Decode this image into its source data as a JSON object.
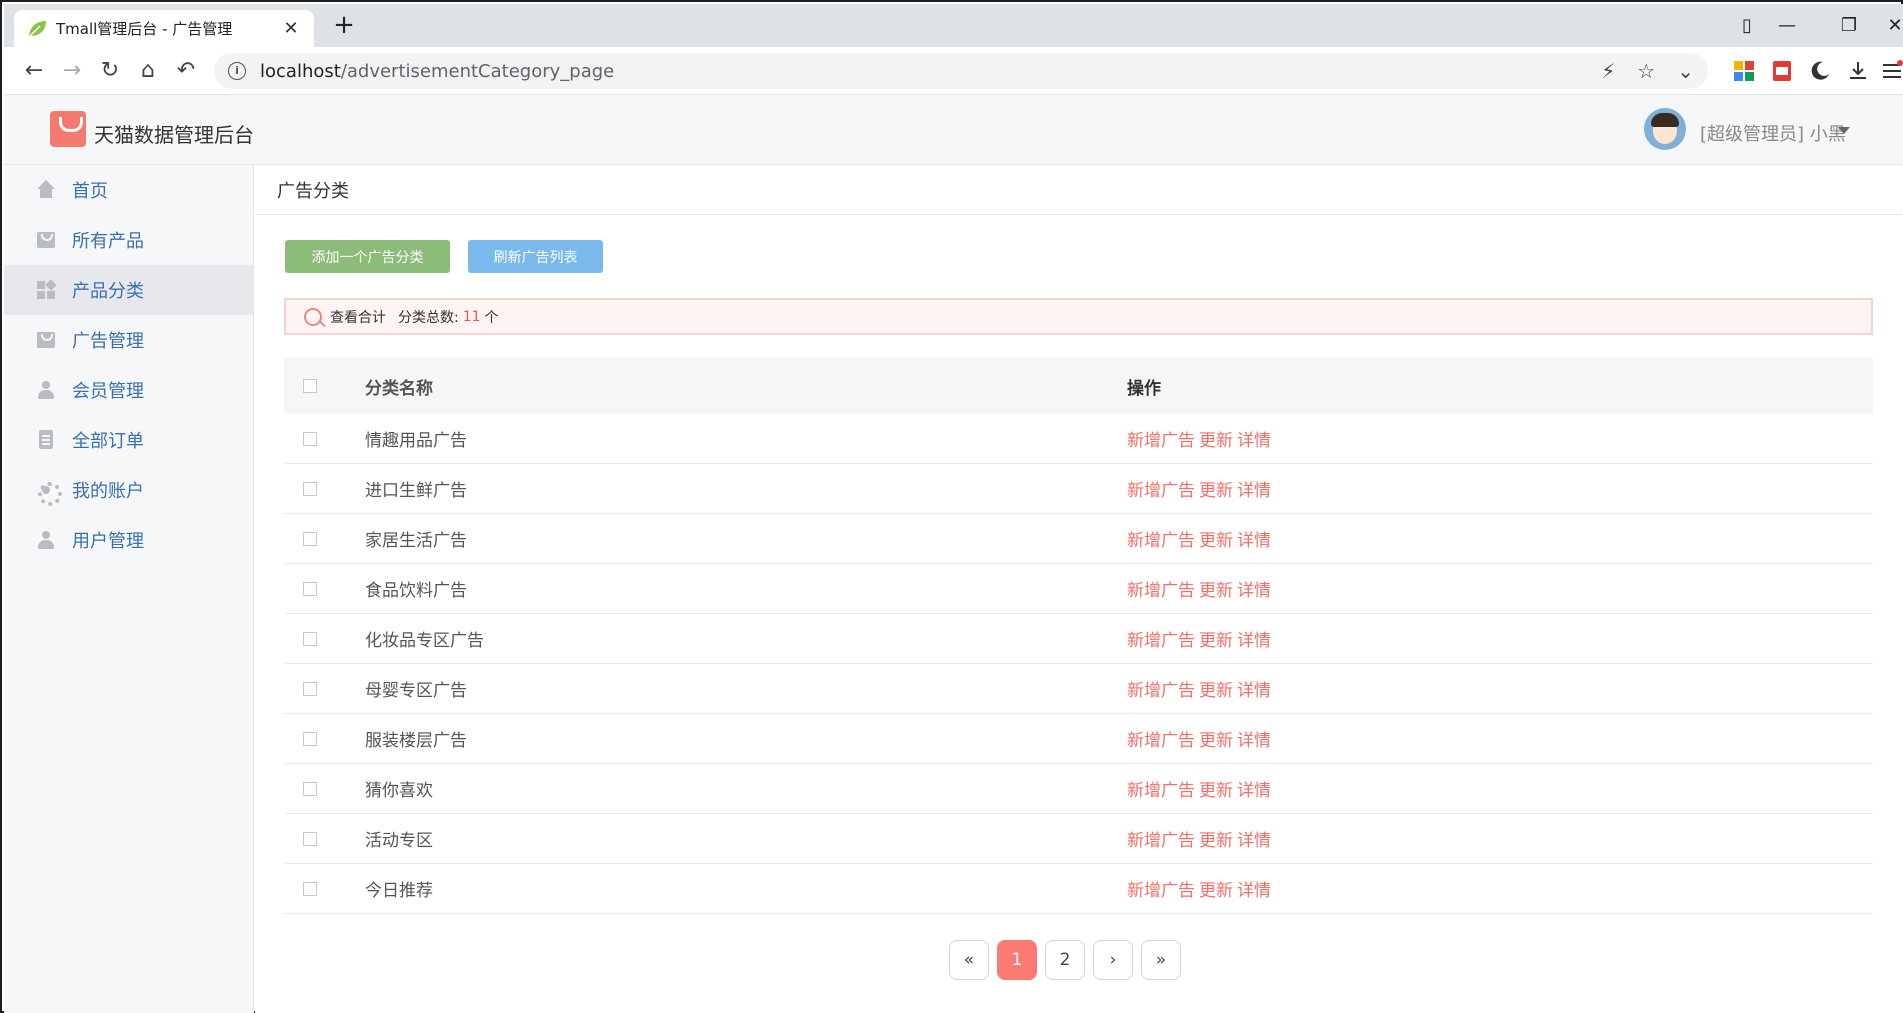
{
  "browser": {
    "tab_title": "Tmall管理后台 - 广告管理",
    "url_host": "localhost",
    "url_path": "/advertisementCategory_page"
  },
  "header": {
    "brand": "天猫数据管理后台",
    "user_label": "[超级管理员] 小黑"
  },
  "sidebar": {
    "items": [
      {
        "label": "首页",
        "icon": "home-icon"
      },
      {
        "label": "所有产品",
        "icon": "product-icon"
      },
      {
        "label": "产品分类",
        "icon": "category-icon"
      },
      {
        "label": "广告管理",
        "icon": "ad-icon"
      },
      {
        "label": "会员管理",
        "icon": "member-icon"
      },
      {
        "label": "全部订单",
        "icon": "order-icon"
      },
      {
        "label": "我的账户",
        "icon": "gear-icon"
      },
      {
        "label": "用户管理",
        "icon": "user-icon"
      }
    ],
    "active_index": 2
  },
  "main": {
    "page_title": "广告分类",
    "add_button": "添加一个广告分类",
    "refresh_button": "刷新广告列表",
    "summary": {
      "label": "查看合计",
      "count_label": "分类总数:",
      "count": "11",
      "unit": "个"
    },
    "table": {
      "headers": [
        "分类名称",
        "操作"
      ],
      "rows": [
        "情趣用品广告",
        "进口生鲜广告",
        "家居生活广告",
        "食品饮料广告",
        "化妆品专区广告",
        "母婴专区广告",
        "服装楼层广告",
        "猜你喜欢",
        "活动专区",
        "今日推荐"
      ],
      "actions": {
        "add": "新增广告",
        "update": "更新",
        "detail": "详情"
      }
    },
    "pagination": {
      "first": "«",
      "pages": [
        "1",
        "2"
      ],
      "next": "›",
      "last": "»",
      "current": "1"
    }
  },
  "colors": {
    "accent": "#fb7a74",
    "link": "#3a6fae",
    "green_button": "#8dbb7a",
    "blue_button": "#7ab9ec"
  }
}
